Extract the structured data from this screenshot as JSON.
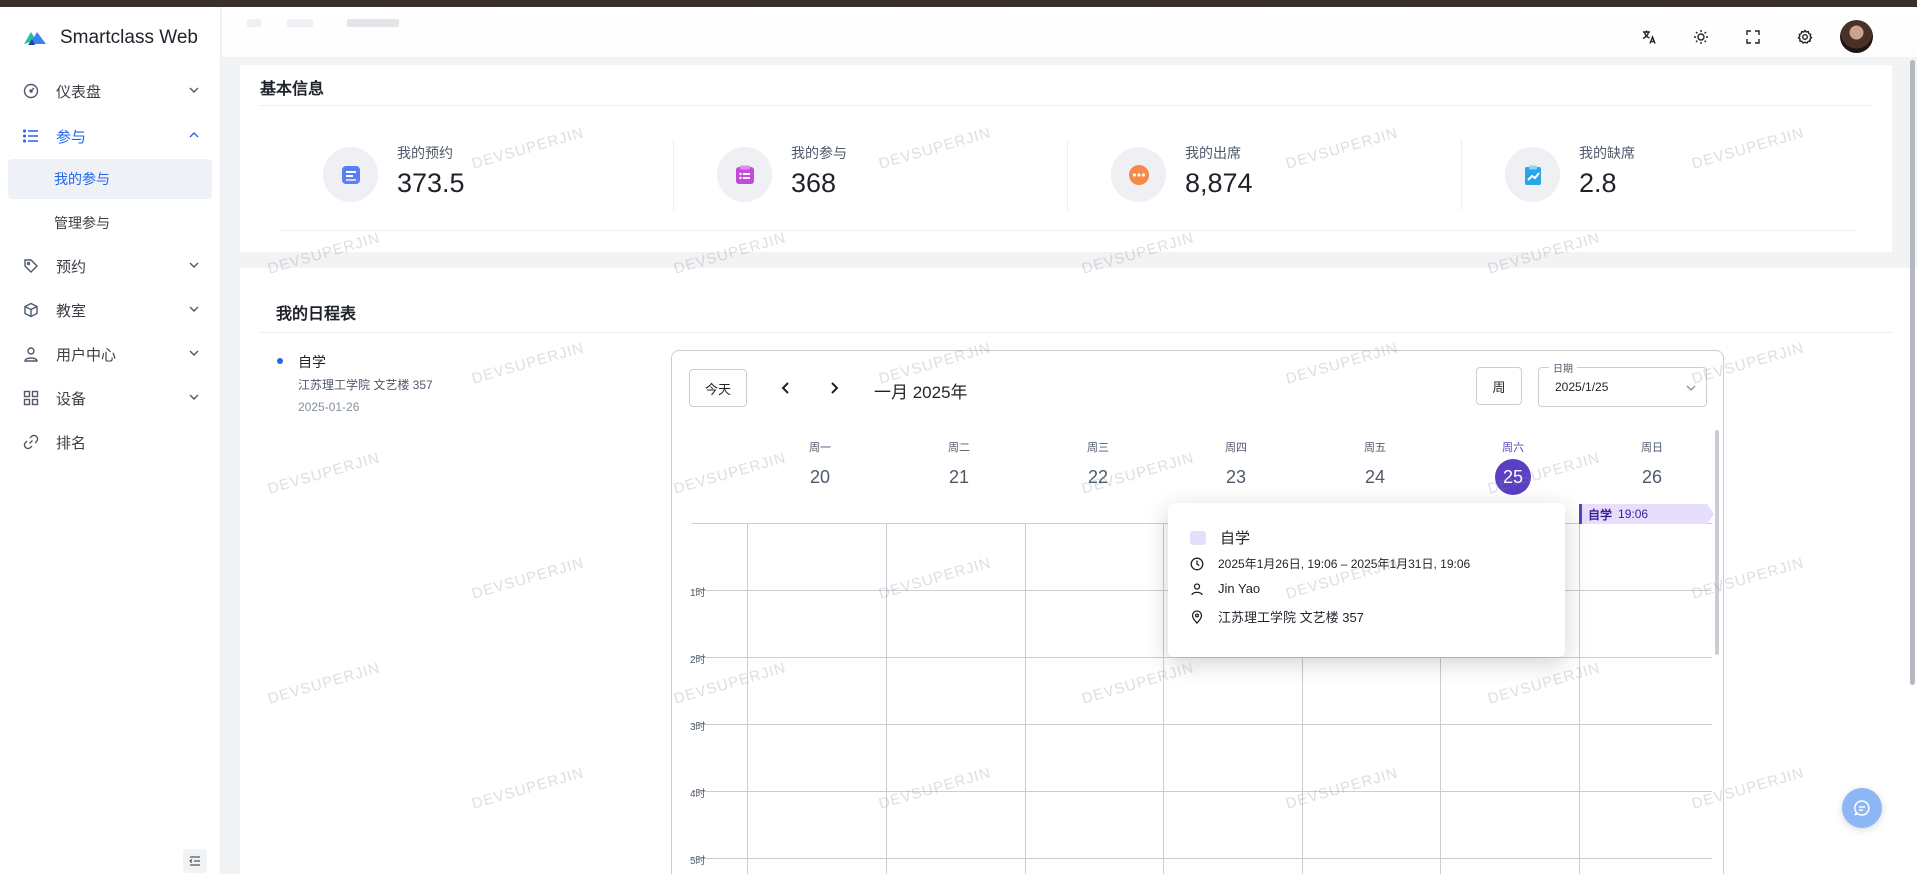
{
  "app": {
    "name": "Smartclass Web"
  },
  "sidebar": {
    "items": [
      {
        "label": "仪表盘",
        "icon": "dashboard-icon"
      },
      {
        "label": "参与",
        "icon": "list-icon"
      },
      {
        "label": "预约",
        "icon": "tag-icon"
      },
      {
        "label": "教室",
        "icon": "cube-icon"
      },
      {
        "label": "用户中心",
        "icon": "user-icon"
      },
      {
        "label": "设备",
        "icon": "grid-icon"
      },
      {
        "label": "排名",
        "icon": "link-icon"
      }
    ],
    "sub_items": [
      {
        "label": "我的参与",
        "selected": true
      },
      {
        "label": "管理参与",
        "selected": false
      }
    ]
  },
  "header": {
    "icons": [
      "translate-icon",
      "theme-icon",
      "fullscreen-icon",
      "settings-icon"
    ]
  },
  "stats": {
    "title": "基本信息",
    "items": [
      {
        "label": "我的预约",
        "value": "373.5",
        "color": "#5b7ff2"
      },
      {
        "label": "我的参与",
        "value": "368",
        "color": "#c44ad9"
      },
      {
        "label": "我的出席",
        "value": "8,874",
        "color": "#f5894a"
      },
      {
        "label": "我的缺席",
        "value": "2.8",
        "color": "#2aa5e8"
      }
    ]
  },
  "schedule": {
    "title": "我的日程表",
    "list": [
      {
        "title": "自学",
        "location": "江苏理工学院 文艺楼 357",
        "date": "2025-01-26"
      }
    ],
    "calendar": {
      "today_label": "今天",
      "month_label": "一月 2025年",
      "view_label": "周",
      "date_field_label": "日期",
      "date_value": "2025/1/25",
      "days": [
        {
          "name": "周一",
          "num": "20"
        },
        {
          "name": "周二",
          "num": "21"
        },
        {
          "name": "周三",
          "num": "22"
        },
        {
          "name": "周四",
          "num": "23"
        },
        {
          "name": "周五",
          "num": "24"
        },
        {
          "name": "周六",
          "num": "25",
          "today": true
        },
        {
          "name": "周日",
          "num": "26"
        }
      ],
      "hours": [
        "1时",
        "2时",
        "3时",
        "4时",
        "5时"
      ],
      "event_chip": {
        "title": "自学",
        "time": "19:06"
      },
      "popover": {
        "title": "自学",
        "time_range": "2025年1月26日, 19:06 – 2025年1月31日, 19:06",
        "person": "Jin Yao",
        "location": "江苏理工学院 文艺楼 357",
        "color": "#e6defa"
      }
    }
  },
  "watermark": "DEVSUPERJIN"
}
